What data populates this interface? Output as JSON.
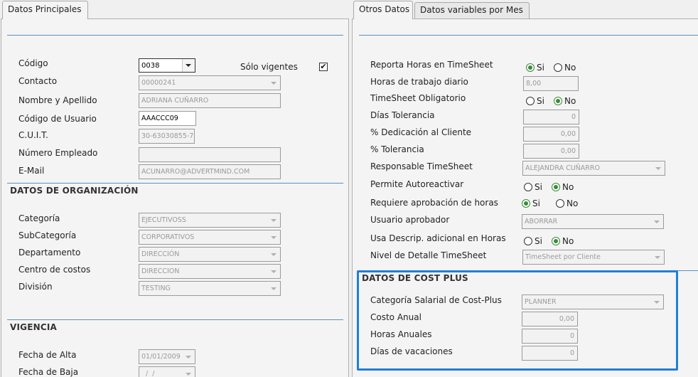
{
  "tabs_left": [
    {
      "label": "Datos Principales"
    }
  ],
  "tabs_right": [
    {
      "label": "Otros Datos"
    },
    {
      "label": "Datos variables por Mes"
    }
  ],
  "left": {
    "codigo": {
      "label": "Código",
      "value": "0038"
    },
    "solo_vigentes": {
      "label": "Sólo vigentes",
      "checked": true,
      "mark": "✔"
    },
    "contacto": {
      "label": "Contacto",
      "value": "00000241"
    },
    "nombre": {
      "label": "Nombre y Apellido",
      "value": "ADRIANA CUÑARRO"
    },
    "codigo_usuario": {
      "label": "Código de Usuario",
      "value": "AAACCC09"
    },
    "cuit": {
      "label": "C.U.I.T.",
      "value": "30-63030855-7"
    },
    "numero_empleado": {
      "label": "Número Empleado",
      "value": ""
    },
    "email": {
      "label": "E-Mail",
      "value": "ACUNARRO@ADVERTMIND.COM"
    },
    "org_title": "DATOS DE ORGANIZACIÓN",
    "categoria": {
      "label": "Categoría",
      "value": "EJECUTIVOSS"
    },
    "subcategoria": {
      "label": "SubCategoría",
      "value": "CORPORATIVOS"
    },
    "departamento": {
      "label": "Departamento",
      "value": "DIRECCIÓN"
    },
    "centro_costos": {
      "label": "Centro de costos",
      "value": "DIRECCION"
    },
    "division": {
      "label": "División",
      "value": "TESTING"
    },
    "vigencia_title": "VIGENCIA",
    "fecha_alta": {
      "label": "Fecha de Alta",
      "value": "01/01/2009"
    },
    "fecha_baja": {
      "label": "Fecha de Baja",
      "value": "  /  /"
    }
  },
  "right": {
    "reporta_horas": {
      "label": "Reporta Horas en TimeSheet",
      "yes": "Si",
      "no": "No",
      "selected": "Si"
    },
    "horas_diario": {
      "label": "Horas de trabajo diario",
      "value": "8,00"
    },
    "timesheet_obligatorio": {
      "label": "TimeSheet Obligatorio",
      "yes": "Si",
      "no": "No",
      "selected": "No"
    },
    "dias_tolerancia": {
      "label": "Días Tolerancia",
      "value": "0"
    },
    "dedicacion_cliente": {
      "label": "% Dedicación al Cliente",
      "value": "0,00"
    },
    "tolerancia": {
      "label": "% Tolerancia",
      "value": "0,00"
    },
    "responsable": {
      "label": "Responsable TimeSheet",
      "value": "ALEJANDRA CUÑARRO"
    },
    "permite_autoreactivar": {
      "label": "Permite Autoreactivar",
      "yes": "Si",
      "no": "No",
      "selected": "No"
    },
    "requiere_aprobacion": {
      "label": "Requiere aprobación de horas",
      "yes": "Si",
      "no": "No",
      "selected": "Si"
    },
    "usuario_aprobador": {
      "label": "Usuario aprobador",
      "value": "ABORRAR"
    },
    "usa_descrip": {
      "label": "Usa Descrip. adicional en Horas",
      "yes": "Si",
      "no": "No",
      "selected": "No"
    },
    "nivel_detalle": {
      "label": "Nivel de Detalle TimeSheet",
      "value": "TimeSheet por Cliente"
    },
    "cost_plus_title": "DATOS DE COST PLUS",
    "categoria_salarial": {
      "label": "Categoría Salarial de Cost-Plus",
      "value": "PLANNER"
    },
    "costo_anual": {
      "label": "Costo Anual",
      "value": "0,00"
    },
    "horas_anuales": {
      "label": "Horas Anuales",
      "value": "0"
    },
    "dias_vacaciones": {
      "label": "Días de vacaciones",
      "value": "0"
    }
  },
  "colors": {
    "accent_blue": "#1f7fd6",
    "rule_blue": "#5b8fc7",
    "radio_green": "#3a8a3a"
  }
}
